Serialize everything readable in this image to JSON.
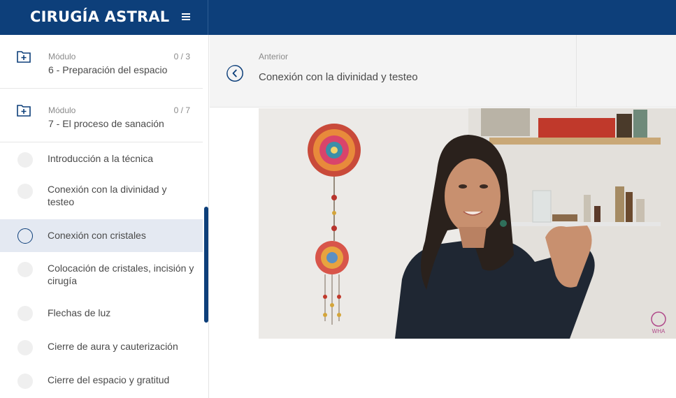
{
  "app": {
    "title": "CIRUGÍA ASTRAL"
  },
  "sidebar": {
    "modules": [
      {
        "label": "Módulo",
        "count": "0 / 3",
        "title": "6 - Preparación del espacio"
      },
      {
        "label": "Módulo",
        "count": "0 / 7",
        "title": "7 - El proceso de sanación"
      }
    ],
    "lessons": [
      {
        "label": "Introducción a la técnica"
      },
      {
        "label": "Conexión con la divinidad y testeo"
      },
      {
        "label": "Conexión con cristales"
      },
      {
        "label": "Colocación de cristales, incisión y cirugía"
      },
      {
        "label": "Flechas de luz"
      },
      {
        "label": "Cierre de aura y cauterización"
      },
      {
        "label": "Cierre del espacio y gratitud"
      }
    ],
    "active_lesson": "Conexión con cristales"
  },
  "nav": {
    "prev_label": "Anterior",
    "prev_title": "Conexión con la divinidad y testeo"
  },
  "video": {
    "watermark": "WHA"
  },
  "icons": {
    "menu": "menu-icon",
    "folder": "folder-plus-icon",
    "prev": "chevron-left-icon"
  },
  "colors": {
    "primary": "#0d3f7a",
    "active_bg": "#e4e9f2"
  }
}
